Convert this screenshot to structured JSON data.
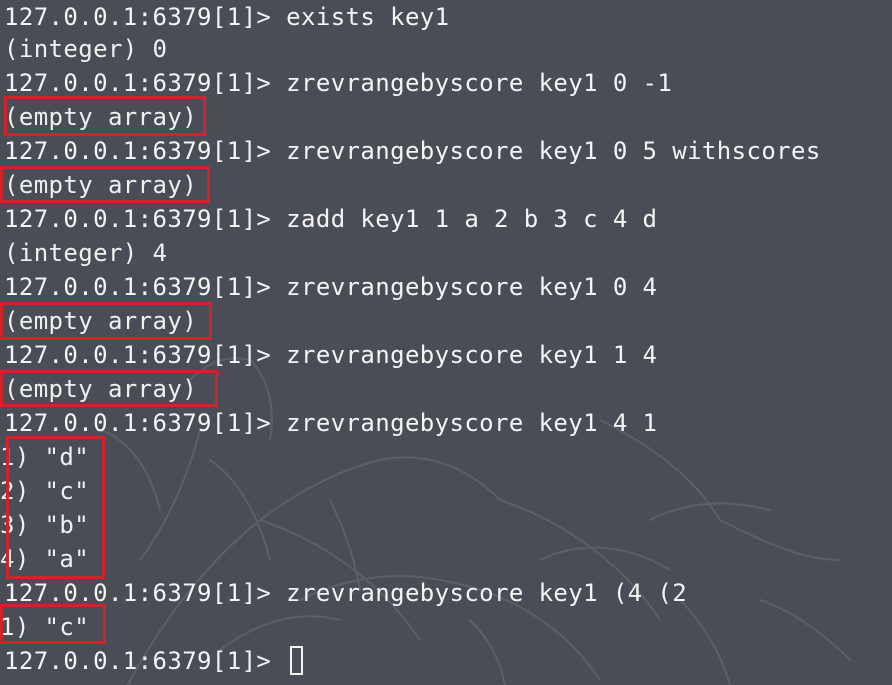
{
  "terminal": {
    "prompt": "127.0.0.1:6379[1]>",
    "lines": [
      {
        "kind": "command",
        "text": " exists key1"
      },
      {
        "kind": "output",
        "text": "(integer) 0"
      },
      {
        "kind": "command",
        "text": " zrevrangebyscore key1 0 -1"
      },
      {
        "kind": "output",
        "text": "(empty array)"
      },
      {
        "kind": "command",
        "text": " zrevrangebyscore key1 0 5 withscores"
      },
      {
        "kind": "output",
        "text": "(empty array)"
      },
      {
        "kind": "command",
        "text": " zadd key1 1 a 2 b 3 c 4 d"
      },
      {
        "kind": "output",
        "text": "(integer) 4"
      },
      {
        "kind": "command",
        "text": " zrevrangebyscore key1 0 4"
      },
      {
        "kind": "output",
        "text": "(empty array)"
      },
      {
        "kind": "command",
        "text": " zrevrangebyscore key1 1 4"
      },
      {
        "kind": "output",
        "text": "(empty array)"
      },
      {
        "kind": "command",
        "text": " zrevrangebyscore key1 4 1"
      },
      {
        "kind": "output",
        "text": "1) \"d\""
      },
      {
        "kind": "output",
        "text": "2) \"c\""
      },
      {
        "kind": "output",
        "text": "3) \"b\""
      },
      {
        "kind": "output",
        "text": "4) \"a\""
      },
      {
        "kind": "command",
        "text": " zrevrangebyscore key1 (4 (2"
      },
      {
        "kind": "output",
        "text": "1) \"c\""
      },
      {
        "kind": "input",
        "text": " "
      }
    ]
  },
  "colors": {
    "background": "#4a4d55",
    "text": "#f2f2f2",
    "highlight": "#d2232a"
  },
  "icons": {
    "cursor": "block-cursor-icon"
  }
}
